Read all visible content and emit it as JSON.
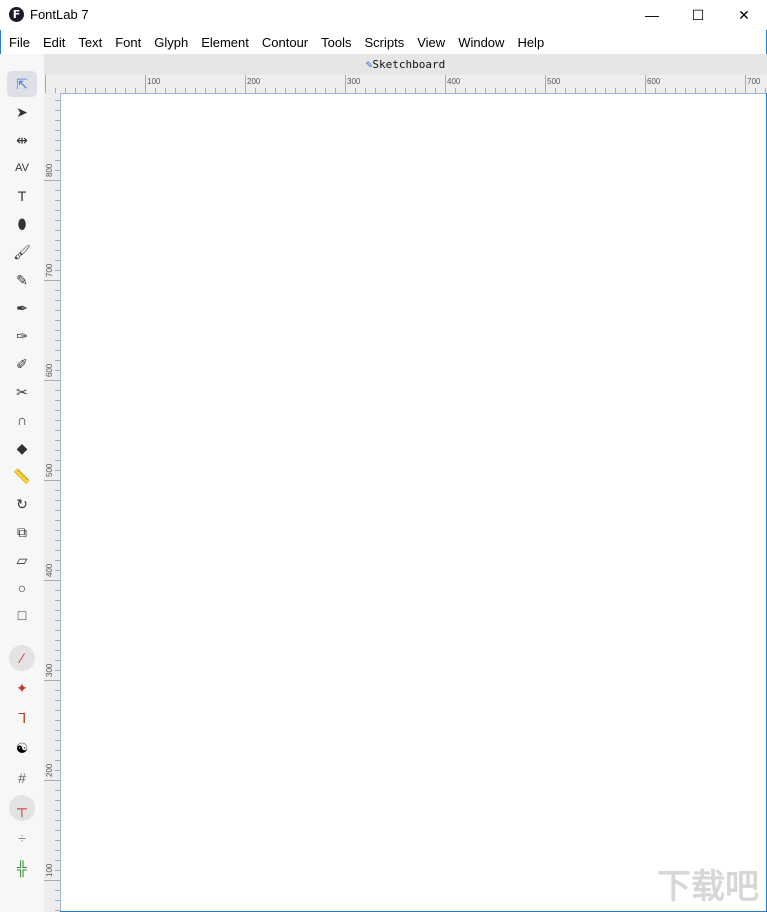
{
  "app": {
    "title": "FontLab 7",
    "logo_letter": "F"
  },
  "window_controls": {
    "minimize": "—",
    "maximize": "☐",
    "close": "✕"
  },
  "menu": [
    "File",
    "Edit",
    "Text",
    "Font",
    "Glyph",
    "Element",
    "Contour",
    "Tools",
    "Scripts",
    "View",
    "Window",
    "Help"
  ],
  "tab": {
    "icon": "pen-icon",
    "label": "Sketchboard"
  },
  "tools": [
    {
      "name": "contour-select-tool",
      "glyph": "⇱",
      "selected": true
    },
    {
      "name": "element-select-tool",
      "glyph": "➤"
    },
    {
      "name": "metrics-tool",
      "glyph": "⇹"
    },
    {
      "name": "kerning-tool",
      "glyph": "AV"
    },
    {
      "name": "text-tool",
      "glyph": "T"
    },
    {
      "name": "eraser-tool",
      "glyph": "⬮"
    },
    {
      "name": "brush-tool",
      "glyph": "🖌"
    },
    {
      "name": "pencil-tool",
      "glyph": "✎"
    },
    {
      "name": "pen-tool",
      "glyph": "✒"
    },
    {
      "name": "rapid-tool",
      "glyph": "✑"
    },
    {
      "name": "power-nib-tool",
      "glyph": "✐"
    },
    {
      "name": "knife-tool",
      "glyph": "✂"
    },
    {
      "name": "magnet-tool",
      "glyph": "∩"
    },
    {
      "name": "fill-tool",
      "glyph": "◆"
    },
    {
      "name": "ruler-tool",
      "glyph": "📏"
    },
    {
      "name": "rotate-tool",
      "glyph": "↻"
    },
    {
      "name": "scale-tool",
      "glyph": "⧉"
    },
    {
      "name": "slant-tool",
      "glyph": "▱"
    },
    {
      "name": "ellipse-tool",
      "glyph": "○"
    },
    {
      "name": "rectangle-tool",
      "glyph": "□"
    },
    {
      "name": "curve-tool",
      "glyph": "⁄",
      "round": true,
      "color": "#c0392b"
    },
    {
      "name": "anchor-tool",
      "glyph": "✦",
      "color": "#c0392b"
    },
    {
      "name": "corner-tool",
      "glyph": "ᒣ",
      "color": "#c0392b"
    },
    {
      "name": "yin-yang-tool",
      "glyph": "☯",
      "color": "#000"
    },
    {
      "name": "grid-tool",
      "glyph": "#",
      "color": "#666"
    },
    {
      "name": "tee-tool",
      "glyph": "┬",
      "round": true,
      "color": "#c0392b"
    },
    {
      "name": "guides-tool",
      "glyph": "÷",
      "color": "#888"
    },
    {
      "name": "hint-tool",
      "glyph": "╬",
      "color": "#2e8b2e"
    }
  ],
  "top_ruler": {
    "labels": [
      100,
      200,
      300,
      400,
      500,
      600,
      700
    ]
  },
  "left_ruler": {
    "labels": [
      800,
      700,
      600,
      500,
      400,
      300,
      200,
      100
    ]
  },
  "watermark": "下载吧"
}
